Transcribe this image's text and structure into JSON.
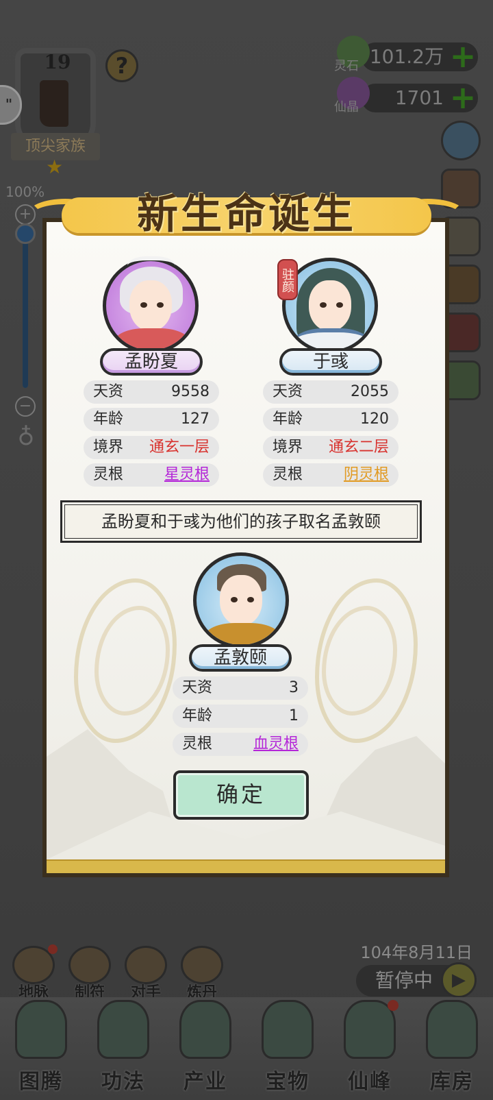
{
  "background": {
    "rank": {
      "level": "19",
      "title": "顶尖家族"
    },
    "zoom": {
      "percent_label": "100%",
      "level": 0.98
    },
    "resources": [
      {
        "name": "灵石",
        "value": "101.2万",
        "icon": "spirit-stone-icon"
      },
      {
        "name": "仙晶",
        "value": "1701",
        "icon": "immortal-crystal-icon"
      }
    ],
    "date": "104年8月11日",
    "pause_label": "暂停中",
    "side_tab_label": "\"",
    "mini_buttons": [
      {
        "label": "地脉",
        "has_badge": true
      },
      {
        "label": "制符",
        "has_badge": false
      },
      {
        "label": "对手",
        "has_badge": false
      },
      {
        "label": "炼丹",
        "has_badge": false
      }
    ],
    "bottom_nav": [
      {
        "label": "图腾",
        "has_badge": false
      },
      {
        "label": "功法",
        "has_badge": false
      },
      {
        "label": "产业",
        "has_badge": false
      },
      {
        "label": "宝物",
        "has_badge": false
      },
      {
        "label": "仙峰",
        "has_badge": true
      },
      {
        "label": "库房",
        "has_badge": false
      }
    ]
  },
  "modal": {
    "title": "新生命诞生",
    "mother": {
      "name": "孟盼夏",
      "stats": [
        {
          "key": "天资",
          "value": "9558"
        },
        {
          "key": "年龄",
          "value": "127"
        },
        {
          "key": "境界",
          "value": "通玄一层"
        },
        {
          "key": "灵根",
          "value": "星灵根"
        }
      ]
    },
    "father": {
      "name": "于彧",
      "tag": "驻颜",
      "stats": [
        {
          "key": "天资",
          "value": "2055"
        },
        {
          "key": "年龄",
          "value": "120"
        },
        {
          "key": "境界",
          "value": "通玄二层"
        },
        {
          "key": "灵根",
          "value": "阴灵根"
        }
      ]
    },
    "message": "孟盼夏和于彧为他们的孩子取名孟敦颐",
    "child": {
      "name": "孟敦颐",
      "stats": [
        {
          "key": "天资",
          "value": "3"
        },
        {
          "key": "年龄",
          "value": "1"
        },
        {
          "key": "灵根",
          "value": "血灵根"
        }
      ]
    },
    "confirm_label": "确定"
  },
  "colors": {
    "realm_red": "#d8322e",
    "root_purple": "#b425d8",
    "root_gold": "#e19a22",
    "confirm_green": "#b9e6cf",
    "title_gold": "#f4c64a"
  }
}
